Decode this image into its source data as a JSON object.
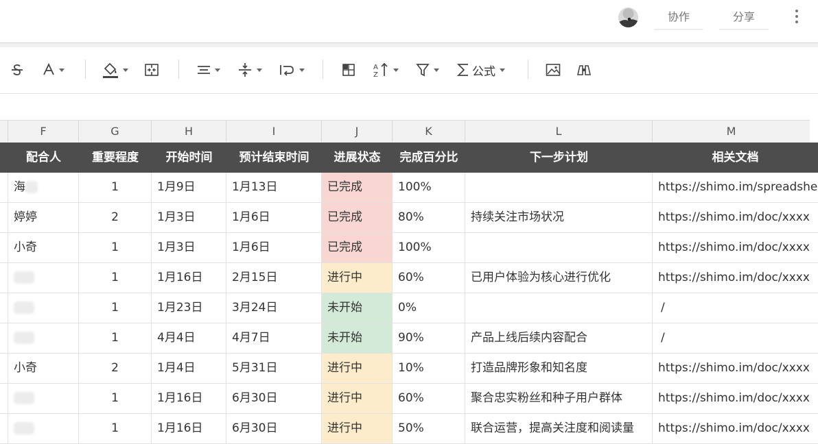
{
  "topbar": {
    "collab_label": "协作",
    "share_label": "分享"
  },
  "toolbar": {
    "formula_label": "公式",
    "icons": [
      "strikethrough-icon",
      "text-color-icon",
      "fill-color-icon",
      "merge-cells-icon",
      "align-center-icon",
      "vertical-align-icon",
      "wrap-text-icon",
      "freeze-icon",
      "sort-icon",
      "filter-icon",
      "sum-icon",
      "image-icon",
      "binoculars-icon"
    ]
  },
  "columns": [
    "F",
    "G",
    "H",
    "I",
    "J",
    "K",
    "L",
    "M"
  ],
  "headers": [
    "配合人",
    "重要程度",
    "开始时间",
    "预计结束时间",
    "进展状态",
    "完成百分比",
    "下一步计划",
    "相关文档"
  ],
  "status_colors": {
    "已完成": "#f8d7d3",
    "进行中": "#fdeccc",
    "未开始": "#d4ead8"
  },
  "rows": [
    {
      "person": "海",
      "blur": true,
      "importance": "1",
      "start": "1月9日",
      "end": "1月13日",
      "status": "已完成",
      "percent": "100%",
      "plan": "",
      "doc": "https://shimo.im/spreadsheets/"
    },
    {
      "person": "婷婷",
      "blur": false,
      "importance": "2",
      "start": "1月3日",
      "end": "1月6日",
      "status": "已完成",
      "percent": "80%",
      "plan": "持续关注市场状况",
      "doc": "https://shimo.im/doc/xxxx"
    },
    {
      "person": "小奇",
      "blur": false,
      "importance": "1",
      "start": "1月3日",
      "end": "1月6日",
      "status": "已完成",
      "percent": "100%",
      "plan": "",
      "doc": "https://shimo.im/doc/xxxx"
    },
    {
      "person": "",
      "blur": true,
      "importance": "1",
      "start": "1月16日",
      "end": "2月15日",
      "status": "进行中",
      "percent": "60%",
      "plan": "已用户体验为核心进行优化",
      "doc": "https://shimo.im/doc/xxxx"
    },
    {
      "person": "",
      "blur": true,
      "importance": "1",
      "start": "1月23日",
      "end": "3月24日",
      "status": "未开始",
      "percent": "0%",
      "plan": "",
      "doc": "/"
    },
    {
      "person": "",
      "blur": true,
      "importance": "1",
      "start": "4月4日",
      "end": "4月7日",
      "status": "未开始",
      "percent": "90%",
      "plan": "产品上线后续内容配合",
      "doc": "/"
    },
    {
      "person": "小奇",
      "blur": false,
      "importance": "2",
      "start": "1月4日",
      "end": "5月31日",
      "status": "进行中",
      "percent": "10%",
      "plan": "打造品牌形象和知名度",
      "doc": "https://shimo.im/doc/xxxx"
    },
    {
      "person": "",
      "blur": true,
      "importance": "1",
      "start": "1月16日",
      "end": "6月30日",
      "status": "进行中",
      "percent": "60%",
      "plan": "聚合忠实粉丝和种子用户群体",
      "doc": "https://shimo.im/doc/xxxx"
    },
    {
      "person": "",
      "blur": true,
      "importance": "1",
      "start": "1月16日",
      "end": "6月30日",
      "status": "进行中",
      "percent": "50%",
      "plan": "联合运营，提高关注度和阅读量",
      "doc": "https://shimo.im/doc/xxxx"
    }
  ]
}
